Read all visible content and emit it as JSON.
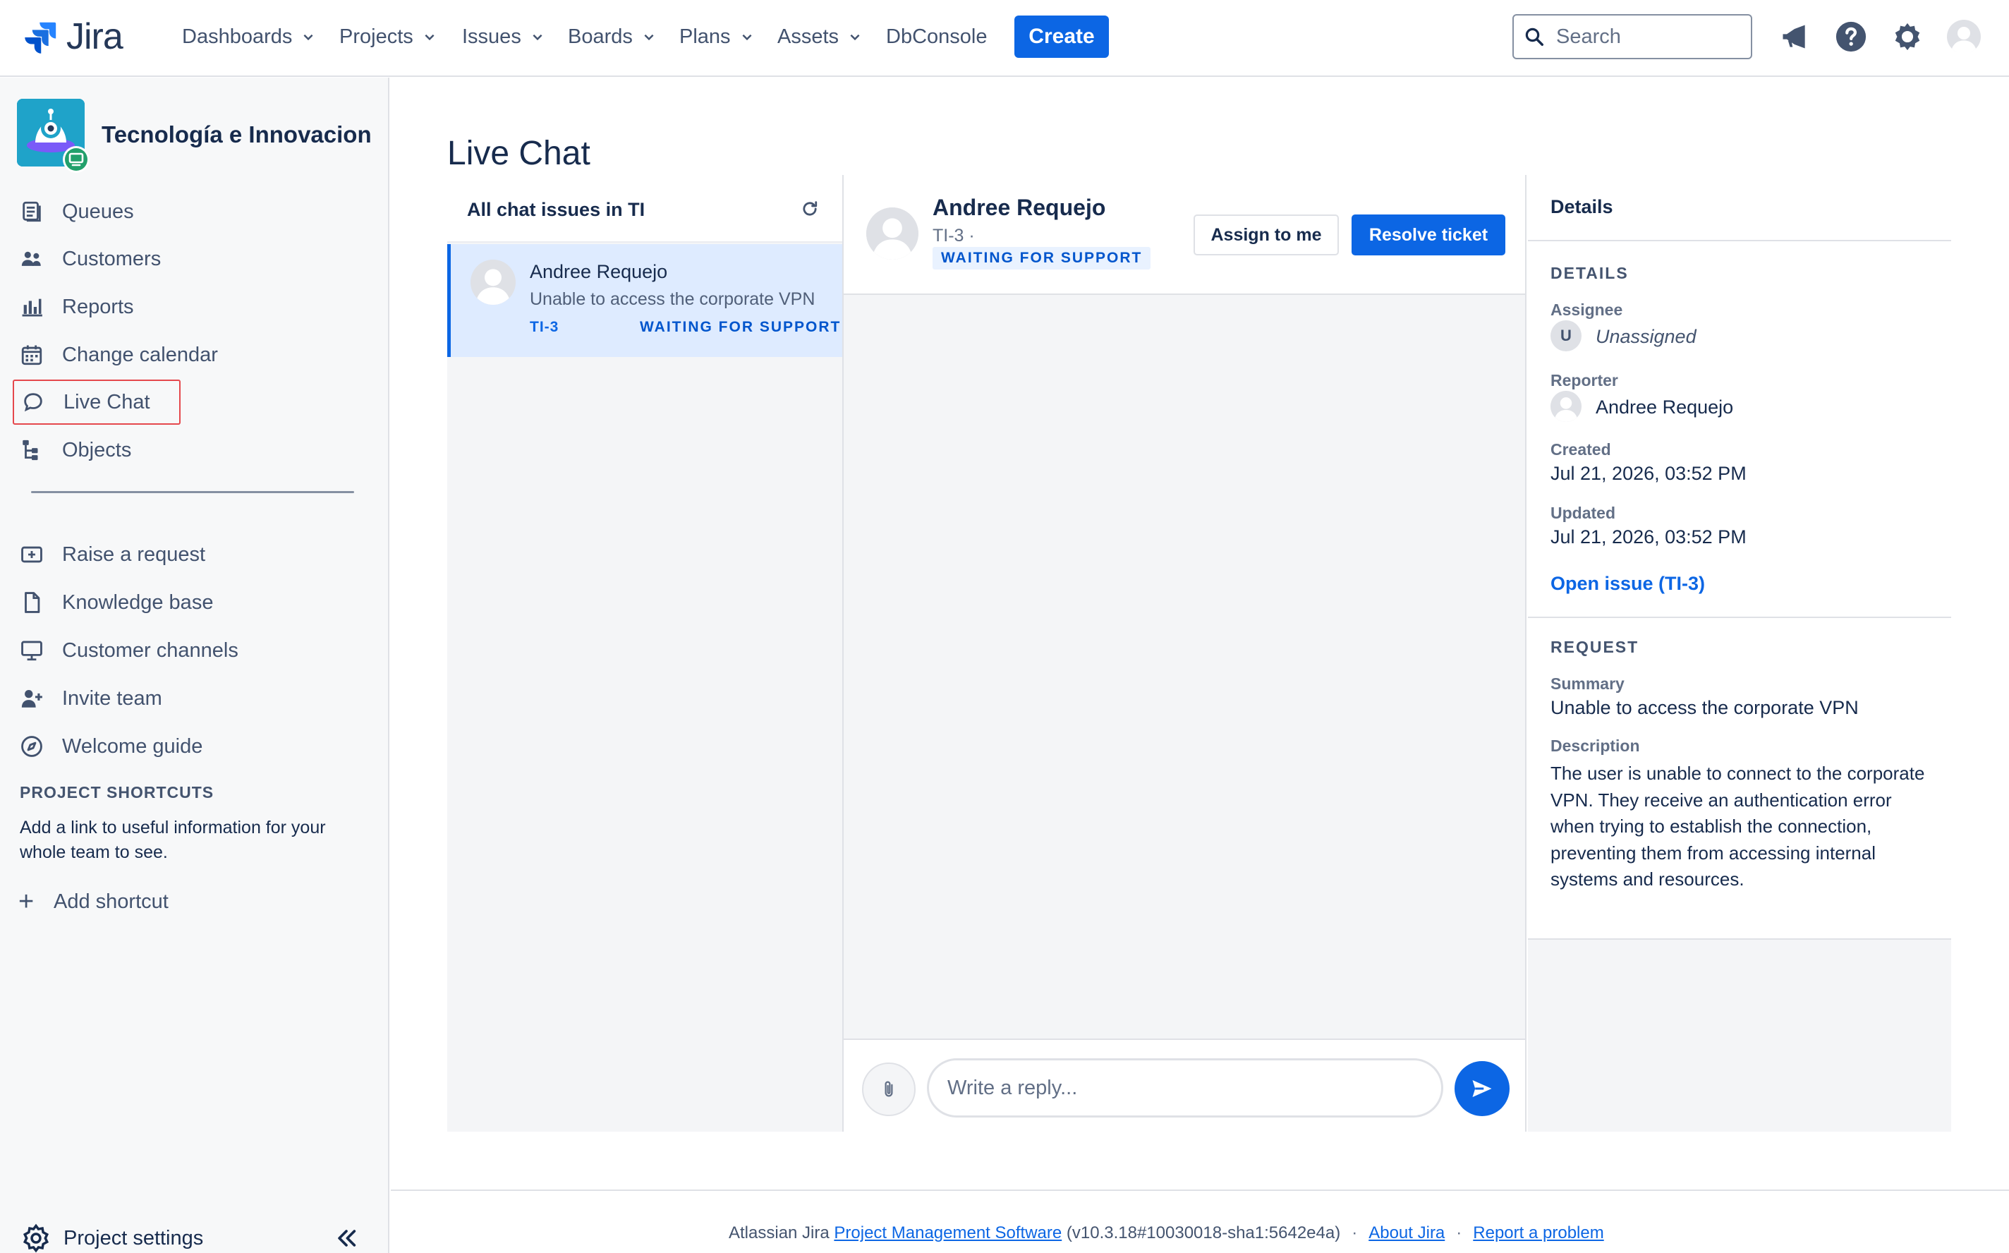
{
  "app": {
    "logo_text": "Jira"
  },
  "topnav": {
    "items": [
      {
        "label": "Dashboards"
      },
      {
        "label": "Projects"
      },
      {
        "label": "Issues"
      },
      {
        "label": "Boards"
      },
      {
        "label": "Plans"
      },
      {
        "label": "Assets"
      },
      {
        "label": "DbConsole"
      }
    ],
    "create_label": "Create",
    "search_placeholder": "Search",
    "icons": [
      "megaphone-icon",
      "help-icon",
      "settings-icon",
      "user-avatar-icon"
    ]
  },
  "sidebar": {
    "project_name": "Tecnología e Innovacion",
    "items": [
      {
        "label": "Queues",
        "icon": "queues-icon"
      },
      {
        "label": "Customers",
        "icon": "customers-icon"
      },
      {
        "label": "Reports",
        "icon": "reports-icon"
      },
      {
        "label": "Change calendar",
        "icon": "calendar-icon"
      },
      {
        "label": "Live Chat",
        "icon": "chat-bubble-icon"
      },
      {
        "label": "Objects",
        "icon": "objects-icon"
      }
    ],
    "secondary_items": [
      {
        "label": "Raise a request",
        "icon": "raise-request-icon"
      },
      {
        "label": "Knowledge base",
        "icon": "page-icon"
      },
      {
        "label": "Customer channels",
        "icon": "monitor-icon"
      },
      {
        "label": "Invite team",
        "icon": "invite-user-icon"
      },
      {
        "label": "Welcome guide",
        "icon": "compass-icon"
      }
    ],
    "shortcuts_heading": "PROJECT SHORTCUTS",
    "shortcuts_description": "Add a link to useful information for your whole team to see.",
    "add_shortcut_label": "Add shortcut",
    "project_settings_label": "Project settings"
  },
  "main": {
    "title": "Live Chat",
    "chat_list": {
      "title": "All chat issues in TI",
      "items": [
        {
          "name": "Andree Requejo",
          "summary": "Unable to access the corporate VPN",
          "key": "TI-3",
          "status": "WAITING FOR SUPPORT"
        }
      ]
    },
    "conversation": {
      "name": "Andree Requejo",
      "key_line": "TI-3 ·",
      "status": "WAITING FOR SUPPORT",
      "assign_label": "Assign to me",
      "resolve_label": "Resolve ticket",
      "reply_placeholder": "Write a reply..."
    },
    "details": {
      "title": "Details",
      "section_details": "DETAILS",
      "assignee_label": "Assignee",
      "assignee_initial": "U",
      "assignee_value": "Unassigned",
      "reporter_label": "Reporter",
      "reporter_value": "Andree Requejo",
      "created_label": "Created",
      "created_value": "Jul 21, 2026, 03:52 PM",
      "updated_label": "Updated",
      "updated_value": "Jul 21, 2026, 03:52 PM",
      "open_issue_label": "Open issue (TI-3)",
      "section_request": "REQUEST",
      "summary_label": "Summary",
      "summary_value": "Unable to access the corporate VPN",
      "description_label": "Description",
      "description_value": "The user is unable to connect to the corporate VPN. They receive an authentication error when trying to establish the connection, preventing them from accessing internal systems and resources."
    }
  },
  "footer": {
    "prefix": "Atlassian Jira ",
    "link_pm": "Project Management Software",
    "version": " (v10.3.18#10030018-sha1:5642e4a)",
    "separator": "·",
    "about": "About Jira",
    "report": "Report a problem"
  },
  "colors": {
    "primary": "#0c66e4",
    "status_text": "#0055cc",
    "selected_bg": "#deebff",
    "highlight_border": "#e5484d"
  }
}
